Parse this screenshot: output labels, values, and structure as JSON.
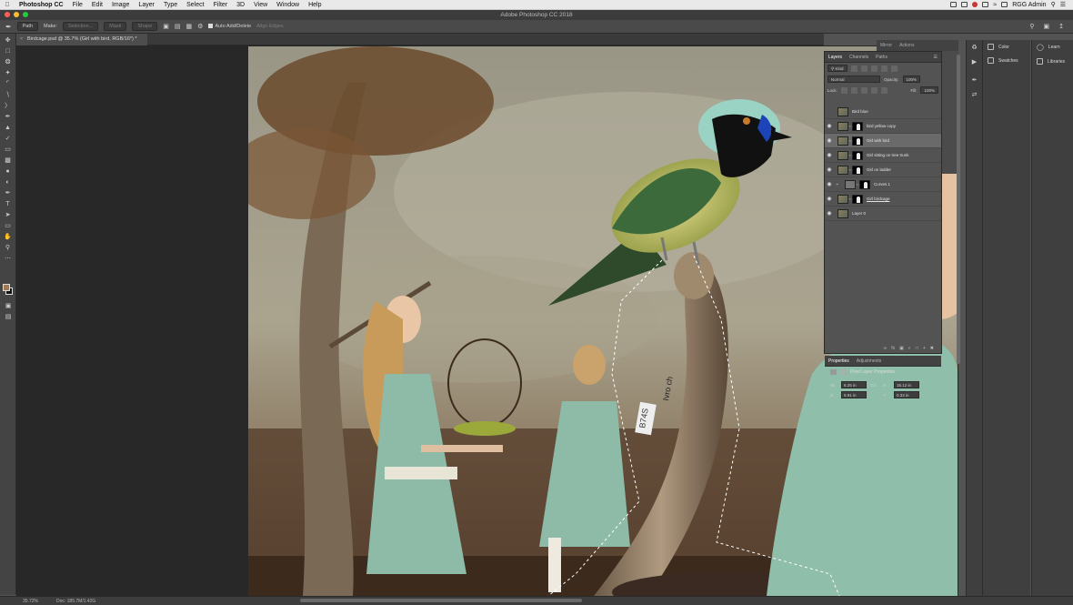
{
  "menubar": {
    "app_name": "Photoshop CC",
    "items": [
      "File",
      "Edit",
      "Image",
      "Layer",
      "Type",
      "Select",
      "Filter",
      "3D",
      "View",
      "Window",
      "Help"
    ],
    "user": "RGG Admin"
  },
  "window": {
    "title": "Adobe Photoshop CC 2018"
  },
  "options_bar": {
    "mode": "Path",
    "make_label": "Make:",
    "selection_btn": "Selection...",
    "mask_btn": "Mask",
    "shape_btn": "Shape",
    "auto_add_delete": "Auto Add/Delete",
    "align_edges": "Align Edges"
  },
  "document": {
    "tab_title": "Birdcage.psd @ 35.7% (Girl with bird, RGB/16*) *"
  },
  "status": {
    "zoom": "35.72%",
    "doc": "Doc: 185.7M/1.42G"
  },
  "mini_panel_tabs": [
    "Mirror",
    "Actions"
  ],
  "layers_panel": {
    "tabs": [
      "Layers",
      "Channels",
      "Paths"
    ],
    "kind_label": "Kind",
    "blend_mode": "Normal",
    "opacity_label": "Opacity:",
    "opacity_value": "100%",
    "lock_label": "Lock:",
    "fill_label": "Fill:",
    "fill_value": "100%",
    "layers": [
      {
        "name": "Bird blue",
        "visible": false,
        "selected": false
      },
      {
        "name": "bird yellow copy",
        "visible": true,
        "selected": false
      },
      {
        "name": "Girl with bird",
        "visible": true,
        "selected": true
      },
      {
        "name": "Girl sitting on tree trunk",
        "visible": true,
        "selected": false
      },
      {
        "name": "Girl on ladder",
        "visible": true,
        "selected": false
      },
      {
        "name": "Curves 1",
        "visible": true,
        "selected": false
      },
      {
        "name": "Girl birdcage",
        "visible": true,
        "selected": false
      },
      {
        "name": "Layer 0",
        "visible": true,
        "selected": false
      }
    ]
  },
  "properties_panel": {
    "tabs": [
      "Properties",
      "Adjustments"
    ],
    "heading": "Pixel Layer Properties",
    "w_label": "W:",
    "w_value": "6.25 in",
    "h_label": "H:",
    "h_value": "15.12 in",
    "x_label": "X:",
    "x_value": "9.91 in",
    "y_label": "Y:",
    "y_value": "0.33 in",
    "go_label": "GO"
  },
  "dock": {
    "col1": [
      {
        "label": "Color",
        "icon": "color-icon"
      },
      {
        "label": "Swatches",
        "icon": "swatches-icon"
      }
    ],
    "col2": [
      {
        "label": "Learn",
        "icon": "learn-icon"
      },
      {
        "label": "Libraries",
        "icon": "libraries-icon"
      }
    ]
  },
  "canvas_tags": {
    "tag_a": "B74S",
    "tag_b": "Ivro ch"
  },
  "colors": {
    "accent": "#2b7fd6",
    "panel_bg": "#535353",
    "selected_row": "#6a6a6a"
  }
}
